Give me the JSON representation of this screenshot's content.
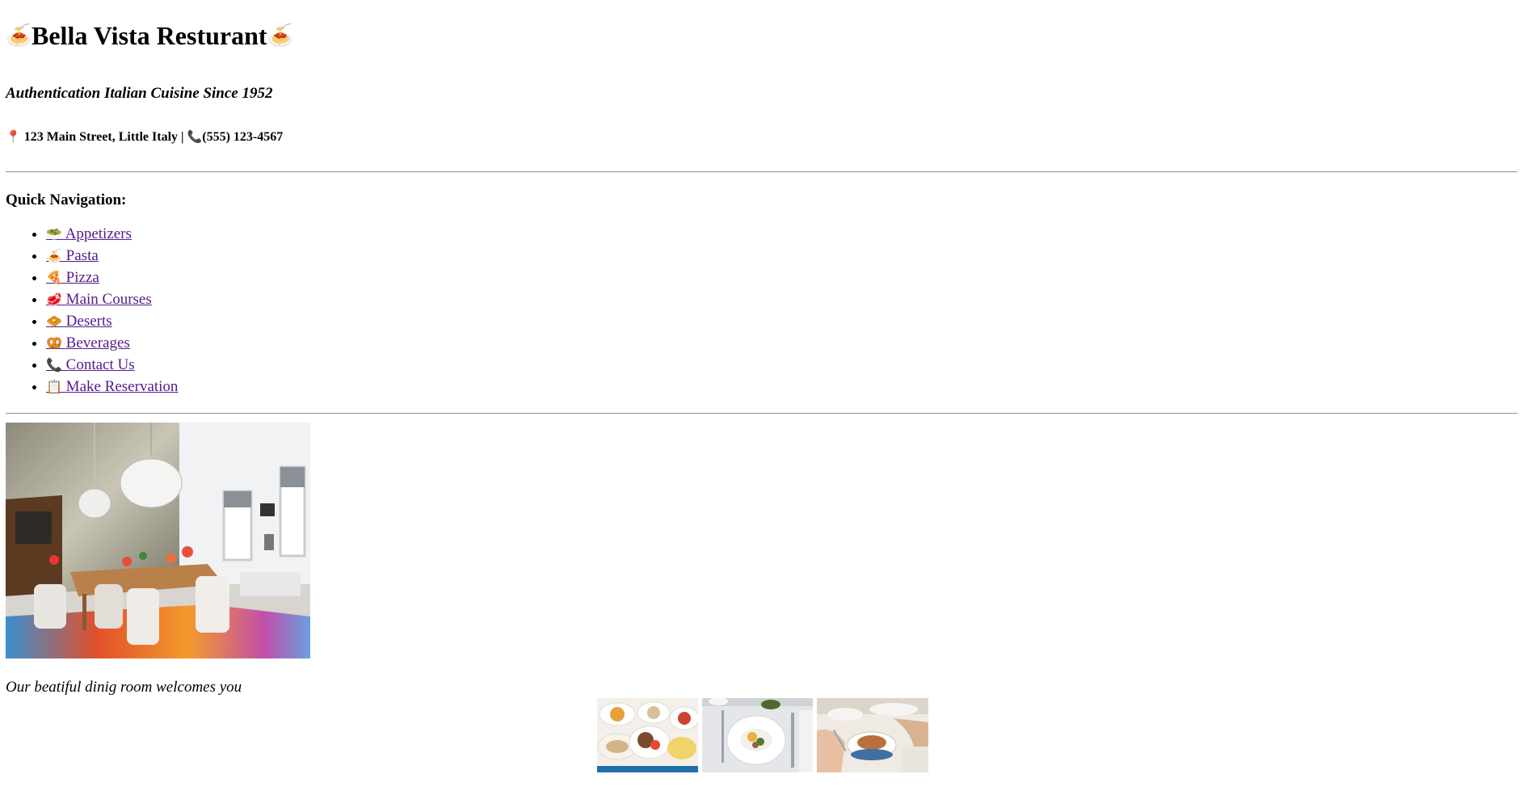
{
  "header": {
    "title_emoji": "🍝",
    "title": "Bella Vista Resturant",
    "tagline": "Authentication Italian Cuisine Since 1952",
    "address_icon": "📍",
    "address": "123 Main Street, Little Italy |",
    "phone_icon": "📞",
    "phone": "(555) 123-4567"
  },
  "nav": {
    "heading": "Quick Navigation:",
    "items": [
      {
        "icon": "🥗",
        "label": "Appetizers"
      },
      {
        "icon": "🍝",
        "label": "Pasta"
      },
      {
        "icon": "🍕",
        "label": "Pizza"
      },
      {
        "icon": "🥩",
        "label": "Main Courses"
      },
      {
        "icon": "🧇",
        "label": "Deserts"
      },
      {
        "icon": "🥨",
        "label": "Beverages"
      },
      {
        "icon": "📞",
        "label": "Contact Us"
      },
      {
        "icon": "📋",
        "label": "Make Reservation"
      }
    ]
  },
  "hero": {
    "caption": "Our beatiful dinig room welcomes you"
  },
  "colors": {
    "link": "#551a8b",
    "divider": "#9a9a9a"
  }
}
